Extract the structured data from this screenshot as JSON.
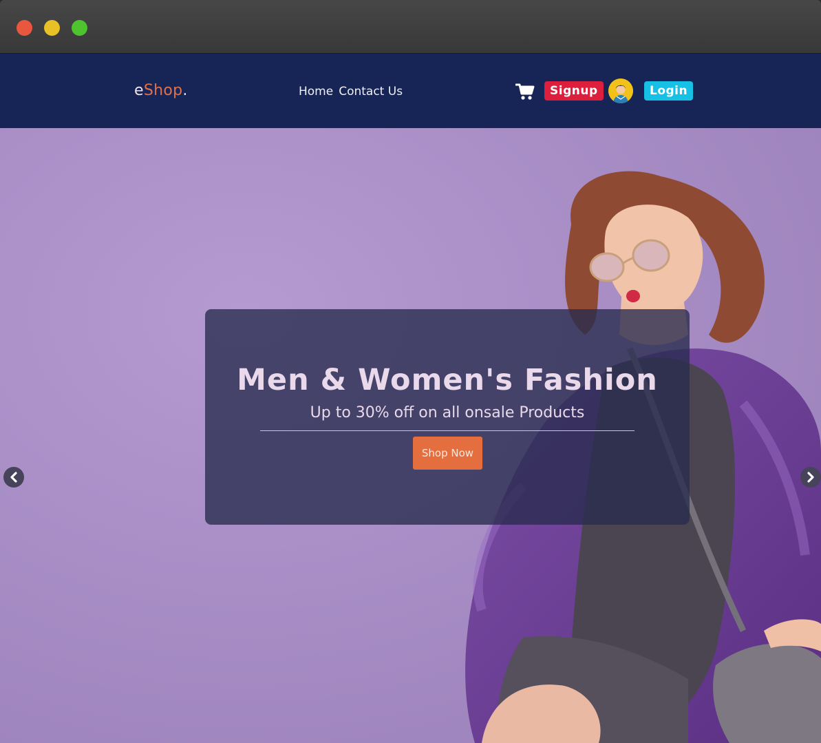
{
  "window": {
    "controls": [
      "close",
      "minimize",
      "maximize"
    ]
  },
  "navbar": {
    "logo": {
      "prefix": "e",
      "brand": "Shop",
      "suffix": "."
    },
    "links": [
      "Home",
      "Contact Us"
    ],
    "cart_icon": "shopping-cart-icon",
    "signup_label": "Signup",
    "login_label": "Login",
    "avatar_icon": "user-avatar"
  },
  "hero": {
    "title": "Men & Women's Fashion",
    "subtitle": "Up to 30% off on all onsale Products",
    "cta_label": "Shop Now",
    "prev_icon": "chevron-left-icon",
    "next_icon": "chevron-right-icon"
  },
  "colors": {
    "navbar_bg": "#172556",
    "logo_accent": "#e2714a",
    "signup_bg": "#dc1f3c",
    "login_bg": "#17c1e6",
    "hero_bg": "#ac91c8",
    "cta_bg": "#e46e3d"
  }
}
